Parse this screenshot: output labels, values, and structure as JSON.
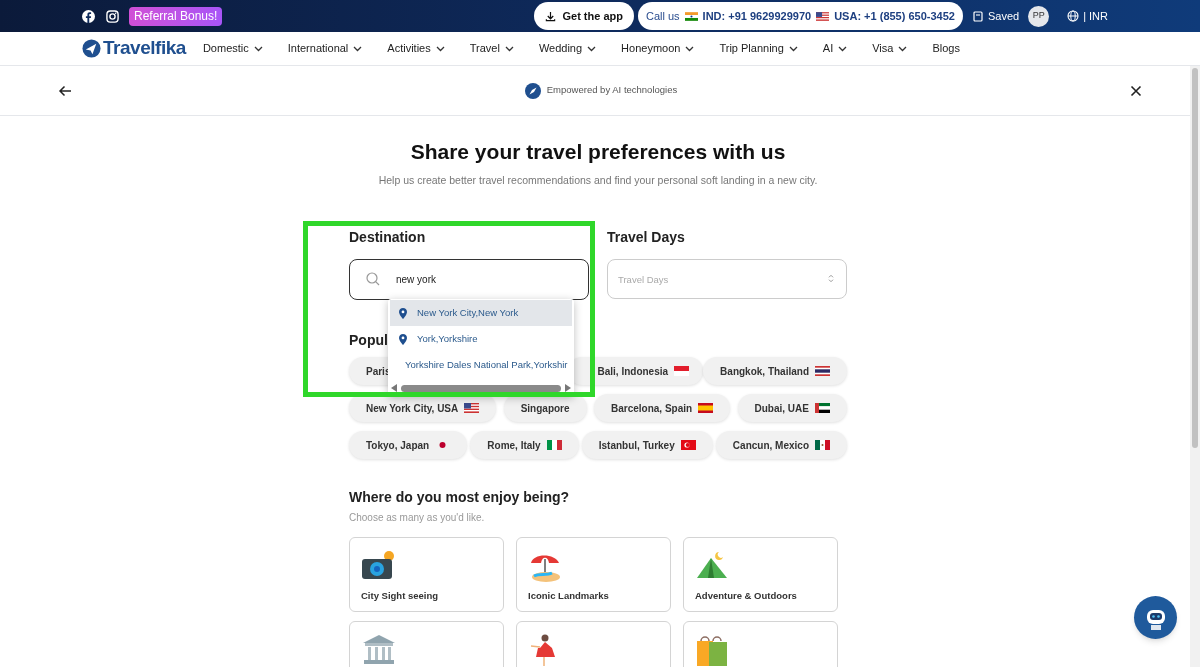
{
  "top_bar": {
    "referral": "Referral Bonus!",
    "get_app": "Get the app",
    "call_label": "Call us",
    "phones": [
      {
        "text": "IND: +91 9629929970"
      },
      {
        "text": "USA: +1 (855) 650-3452"
      }
    ],
    "saved": "Saved",
    "avatar": "PP",
    "currency": "| INR"
  },
  "nav": {
    "logo": "Travelfika",
    "items": [
      {
        "label": "Domestic",
        "dropdown": true
      },
      {
        "label": "International",
        "dropdown": true
      },
      {
        "label": "Activities",
        "dropdown": true
      },
      {
        "label": "Travel",
        "dropdown": true
      },
      {
        "label": "Wedding",
        "dropdown": true
      },
      {
        "label": "Honeymoon",
        "dropdown": true
      },
      {
        "label": "Trip Planning",
        "dropdown": true
      },
      {
        "label": "AI",
        "dropdown": true
      },
      {
        "label": "Visa",
        "dropdown": true
      },
      {
        "label": "Blogs",
        "dropdown": false
      }
    ]
  },
  "subheader": {
    "badge": "Empowered by AI technologies"
  },
  "title": "Share your travel preferences with us",
  "subtitle": "Help us create better travel recommendations and find your personal soft landing in a new city.",
  "destination": {
    "label": "Destination",
    "value": "new york",
    "suggestions": [
      {
        "label": "New York City,New York",
        "pin": true,
        "selected": true
      },
      {
        "label": "York,Yorkshire",
        "pin": true,
        "selected": false
      },
      {
        "label": "Yorkshire Dales National Park,Yorkshir",
        "pin": false,
        "selected": false
      }
    ]
  },
  "travel_days": {
    "label": "Travel Days",
    "placeholder": "Travel Days"
  },
  "popular": {
    "heading": "Popul",
    "chips": [
      {
        "label": "Paris"
      },
      {
        "label": "Bali, Indonesia"
      },
      {
        "label": "Bangkok, Thailand"
      },
      {
        "label": "New York City, USA"
      },
      {
        "label": "Singapore"
      },
      {
        "label": "Barcelona, Spain"
      },
      {
        "label": "Dubai, UAE"
      },
      {
        "label": "Tokyo, Japan"
      },
      {
        "label": "Rome, Italy"
      },
      {
        "label": "Istanbul, Turkey"
      },
      {
        "label": "Cancun, Mexico"
      }
    ]
  },
  "enjoy": {
    "heading": "Where do you most enjoy being?",
    "subheading": "Choose as many as you'd like.",
    "options": [
      {
        "label": "City Sight seeing"
      },
      {
        "label": "Iconic Landmarks"
      },
      {
        "label": "Adventure & Outdoors"
      }
    ]
  }
}
